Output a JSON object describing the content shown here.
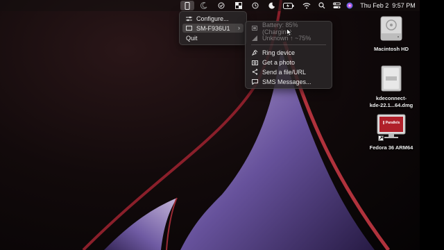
{
  "menubar": {
    "date": "Thu Feb 2",
    "time": "9:57 PM",
    "icons": [
      "kdeconnect-phone-icon",
      "moon-crescent-icon",
      "checkmark-circle-icon",
      "window-grid-icon",
      "history-clock-icon",
      "night-moon-icon",
      "battery-charging-icon",
      "wifi-icon",
      "search-icon",
      "control-center-icon",
      "siri-icon"
    ]
  },
  "kde_menu": {
    "items": [
      {
        "label": "Configure...",
        "icon": "sliders-icon"
      },
      {
        "label": "SM-F936U1",
        "icon": "device-icon"
      },
      {
        "label": "Quit"
      }
    ]
  },
  "device_submenu": {
    "items": [
      {
        "label": "Battery: 85% (Charging)",
        "icon": "battery-icon",
        "disabled": true
      },
      {
        "label": "Unknown ↑ ~75%",
        "icon": "signal-icon",
        "disabled": true
      },
      {
        "label": "Ring device",
        "icon": "ring-icon"
      },
      {
        "label": "Get a photo",
        "icon": "camera-icon"
      },
      {
        "label": "Send a file/URL",
        "icon": "share-icon"
      },
      {
        "label": "SMS Messages...",
        "icon": "message-icon"
      }
    ]
  },
  "desktop": {
    "items": [
      {
        "label": "Macintosh HD",
        "icon": "hard-drive-icon"
      },
      {
        "label_line1": "kdeconnect-",
        "label_line2": "kde-22.1...64.dmg",
        "icon": "dmg-file-icon"
      },
      {
        "label": "Fedora 36 ARM64",
        "icon": "parallels-vm-icon",
        "badge": "|| Parallels"
      }
    ]
  }
}
